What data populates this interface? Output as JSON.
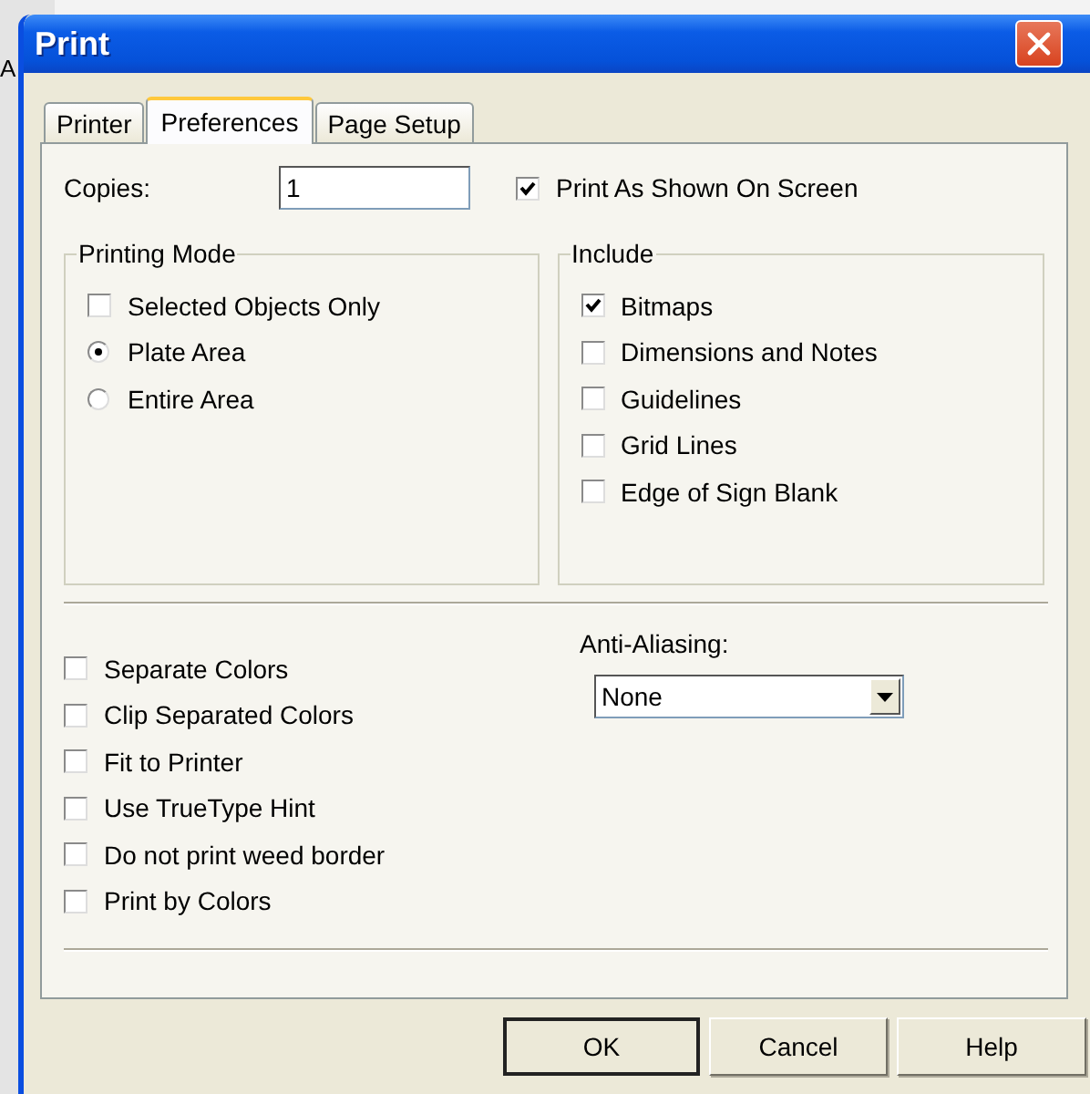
{
  "background": {
    "text": "A"
  },
  "window": {
    "title": "Print"
  },
  "tabs": [
    {
      "label": "Printer",
      "selected": false
    },
    {
      "label": "Preferences",
      "selected": true
    },
    {
      "label": "Page Setup",
      "selected": false
    }
  ],
  "copies": {
    "label": "Copies:",
    "value": "1"
  },
  "print_as_shown": {
    "label": "Print As Shown On Screen",
    "checked": true
  },
  "printing_mode": {
    "title": "Printing Mode",
    "items": [
      {
        "kind": "checkbox",
        "label": "Selected Objects Only",
        "checked": false
      },
      {
        "kind": "radio",
        "label": "Plate Area",
        "selected": true
      },
      {
        "kind": "radio",
        "label": "Entire Area",
        "selected": false
      }
    ]
  },
  "include": {
    "title": "Include",
    "items": [
      {
        "label": "Bitmaps",
        "checked": true
      },
      {
        "label": "Dimensions and Notes",
        "checked": false
      },
      {
        "label": "Guidelines",
        "checked": false
      },
      {
        "label": "Grid Lines",
        "checked": false
      },
      {
        "label": "Edge of Sign Blank",
        "checked": false
      }
    ]
  },
  "options": [
    {
      "label": "Separate Colors",
      "checked": false
    },
    {
      "label": "Clip Separated Colors",
      "checked": false
    },
    {
      "label": "Fit to Printer",
      "checked": false
    },
    {
      "label": "Use TrueType Hint",
      "checked": false
    },
    {
      "label": "Do not print weed border",
      "checked": false
    },
    {
      "label": "Print by Colors",
      "checked": false
    }
  ],
  "anti_aliasing": {
    "label": "Anti-Aliasing:",
    "value": "None"
  },
  "buttons": [
    {
      "label": "OK",
      "default": true
    },
    {
      "label": "Cancel",
      "default": false
    },
    {
      "label": "Help",
      "default": false
    }
  ]
}
